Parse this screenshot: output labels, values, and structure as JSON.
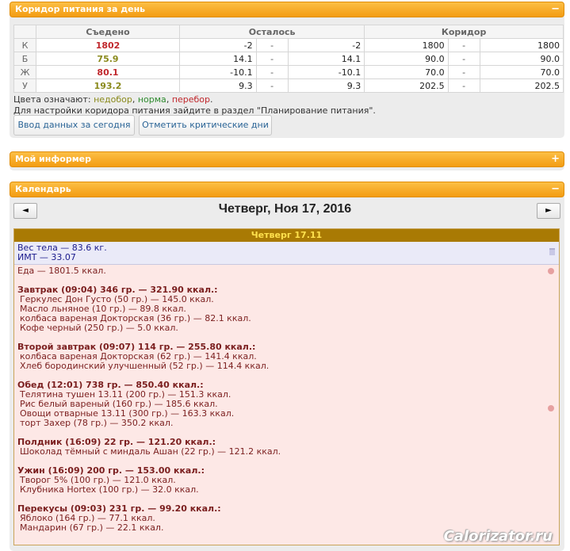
{
  "corridor": {
    "title": "Коридор питания за день",
    "toggle": "−",
    "headers": {
      "eaten": "Съедено",
      "left": "Осталось",
      "corridor": "Коридор"
    },
    "rows": [
      {
        "label": "К",
        "eaten": "1802",
        "eaten_status": "over",
        "left_min": "-2",
        "dash1": "-",
        "left_max": "-2",
        "cor_min": "1800",
        "dash2": "-",
        "cor_max": "1800"
      },
      {
        "label": "Б",
        "eaten": "75.9",
        "eaten_status": "under",
        "left_min": "14.1",
        "dash1": "-",
        "left_max": "14.1",
        "cor_min": "90.0",
        "dash2": "-",
        "cor_max": "90.0"
      },
      {
        "label": "Ж",
        "eaten": "80.1",
        "eaten_status": "over",
        "left_min": "-10.1",
        "dash1": "-",
        "left_max": "-10.1",
        "cor_min": "70.0",
        "dash2": "-",
        "cor_max": "70.0"
      },
      {
        "label": "У",
        "eaten": "193.2",
        "eaten_status": "under",
        "left_min": "9.3",
        "dash1": "-",
        "left_max": "9.3",
        "cor_min": "202.5",
        "dash2": "-",
        "cor_max": "202.5"
      }
    ],
    "legend": {
      "prefix": "Цвета означают: ",
      "under": "недобор",
      "sep1": ", ",
      "norm": "норма",
      "sep2": ", ",
      "over": "перебор",
      "end": "."
    },
    "hint": "Для настройки коридора питания зайдите в раздел \"Планирование питания\".",
    "btn_today": "Ввод данных за сегодня",
    "btn_critical": "Отметить критические дни",
    "colors": {
      "under": "#8a8a1c",
      "norm": "#2e8b2e",
      "over": "#c0282d"
    }
  },
  "informer": {
    "title": "Мой информер",
    "toggle": "+"
  },
  "calendar": {
    "title": "Календарь",
    "toggle": "−",
    "prev": "◄",
    "next": "►",
    "date": "Четверг, Ноя 17, 2016",
    "day_header": "Четверг 17.11",
    "weight": "Вес тела — 83.6 кг.",
    "bmi": "ИМТ — 33.07",
    "food_total": "Еда — 1801.5 ккал.",
    "meals": [
      {
        "title": "Завтрак (09:04) 346 гр. — 321.90 ккал.:",
        "items": [
          "Геркулес Дон Густо (50 гр.) — 145.0 ккал.",
          "Масло льняное (10 гр.) — 89.8 ккал.",
          "колбаса вареная Докторская (36 гр.) — 82.1 ккал.",
          "Кофе черный (250 гр.) — 5.0 ккал."
        ]
      },
      {
        "title": "Второй завтрак (09:07) 114 гр. — 255.80 ккал.:",
        "items": [
          "колбаса вареная Докторская (62 гр.) — 141.4 ккал.",
          "Хлеб бородинский улучшенный (52 гр.) — 114.4 ккал."
        ]
      },
      {
        "title": "Обед (12:01) 738 гр. — 850.40 ккал.:",
        "items": [
          "Телятина тушен 13.11 (200 гр.) — 151.3 ккал.",
          "Рис белый вареный (160 гр.) — 185.6 ккал.",
          "Овощи отварные 13.11 (300 гр.) — 163.3 ккал.",
          "торт Захер (78 гр.) — 350.2 ккал."
        ]
      },
      {
        "title": "Полдник (16:09) 22 гр. — 121.20 ккал.:",
        "items": [
          "Шоколад тёмный с миндаль Ашан (22 гр.) — 121.2 ккал."
        ]
      },
      {
        "title": "Ужин (16:09) 200 гр. — 153.00 ккал.:",
        "items": [
          "Творог 5% (100 гр.) — 121.0 ккал.",
          "Клубника Hortex (100 гр.) — 32.0 ккал."
        ]
      },
      {
        "title": "Перекусы (09:03) 231 гр. — 99.20 ккал.:",
        "items": [
          "Яблоко (164 гр.) — 77.1 ккал.",
          "Мандарин (67 гр.) — 22.1 ккал."
        ]
      }
    ]
  },
  "watermark": "Calorizator.ru"
}
